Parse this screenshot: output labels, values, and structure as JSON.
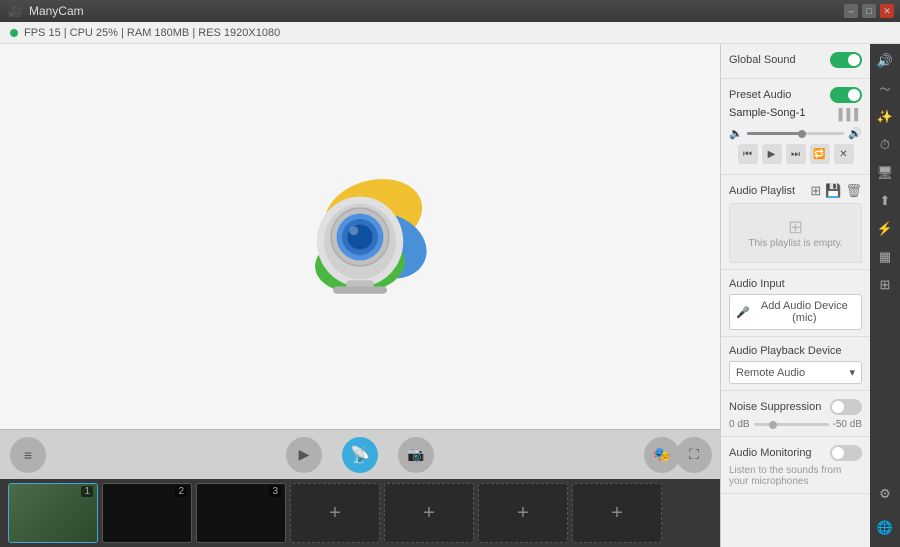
{
  "titlebar": {
    "app_name": "ManyCam",
    "min_btn": "–",
    "max_btn": "□",
    "close_btn": "✕"
  },
  "statsbar": {
    "stats": "FPS 15 | CPU 25% | RAM 180MB | RES 1920X1080"
  },
  "right_panel": {
    "global_sound_label": "Global Sound",
    "preset_audio_label": "Preset Audio",
    "sample_song": "Sample-Song-1",
    "audio_playlist_label": "Audio Playlist",
    "playlist_empty_text": "This playlist is empty.",
    "audio_input_label": "Audio Input",
    "add_device_btn": "Add Audio Device (mic)",
    "audio_playback_label": "Audio Playback Device",
    "playback_device": "Remote Audio",
    "noise_suppression_label": "Noise Suppression",
    "noise_val_left": "0 dB",
    "noise_val_right": "-50 dB",
    "audio_monitoring_label": "Audio Monitoring",
    "audio_monitoring_desc": "Listen to the sounds from your microphones"
  },
  "toolbar": {
    "video_icon": "📹",
    "broadcast_icon": "📡",
    "photo_icon": "📷",
    "mask_icon": "🎭",
    "fullscreen_icon": "⛶",
    "menu_icon": "≡"
  },
  "sources": [
    {
      "id": 1,
      "label": ""
    },
    {
      "id": 2,
      "label": ""
    },
    {
      "id": 3,
      "label": ""
    }
  ],
  "colors": {
    "toggle_on": "#27ae60",
    "accent": "#3aabdd",
    "dark_bg": "#3a3a3a"
  }
}
